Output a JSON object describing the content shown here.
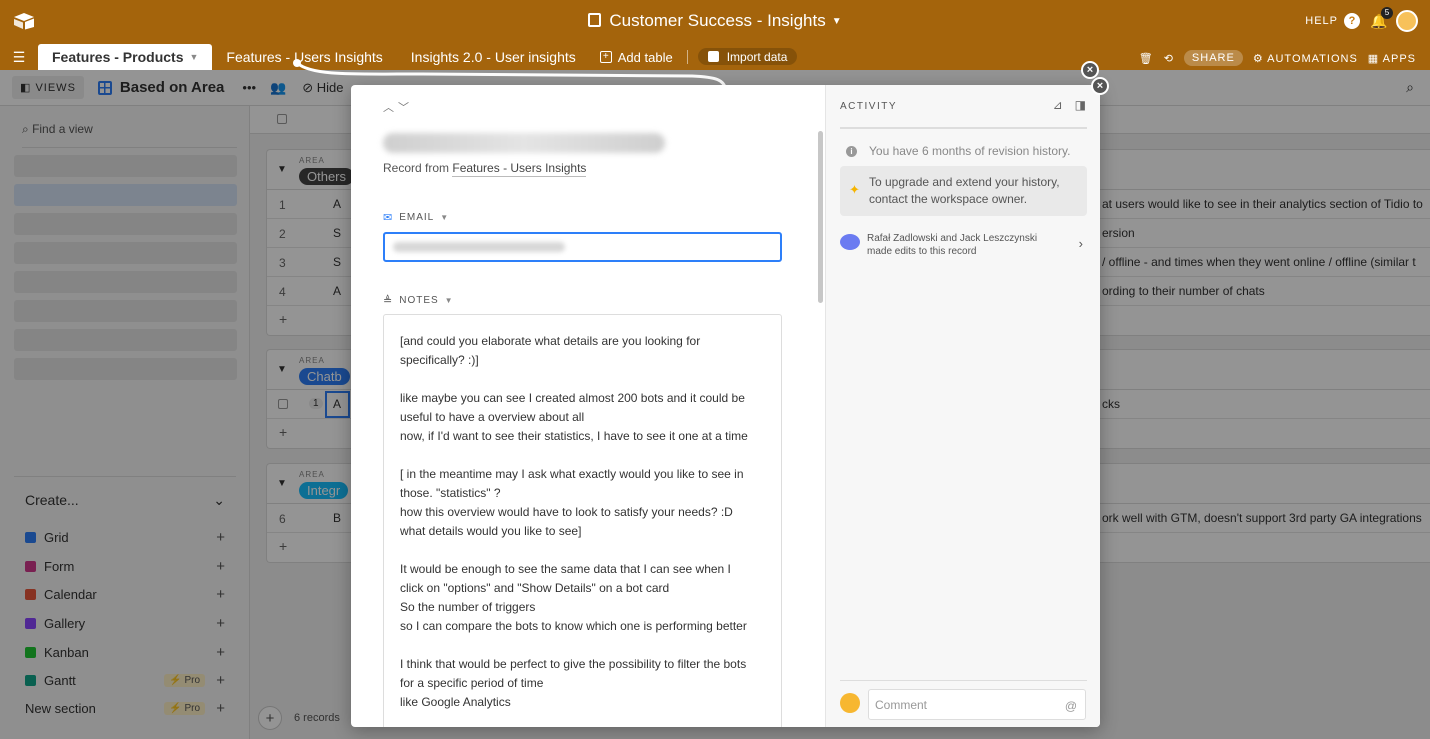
{
  "app": {
    "title": "Customer Success - Insights",
    "help_label": "HELP",
    "notification_count": "5"
  },
  "tabs": {
    "items": [
      {
        "label": "Features - Products",
        "active": true
      },
      {
        "label": "Features - Users Insights",
        "active": false
      },
      {
        "label": "Insights 2.0 - User insights",
        "active": false
      }
    ],
    "add_table": "Add table",
    "import_data": "Import data",
    "share": "SHARE",
    "automations": "AUTOMATIONS",
    "apps": "APPS"
  },
  "toolbar": {
    "views": "VIEWS",
    "view_name": "Based on Area",
    "hide": "Hide"
  },
  "sidebar": {
    "find_view": "Find a view",
    "create": "Create...",
    "types": [
      {
        "label": "Grid",
        "color": "#2d7ff9"
      },
      {
        "label": "Form",
        "color": "#d0388c"
      },
      {
        "label": "Calendar",
        "color": "#e8573c"
      },
      {
        "label": "Gallery",
        "color": "#8b46ff"
      },
      {
        "label": "Kanban",
        "color": "#20c933"
      },
      {
        "label": "Gantt",
        "color": "#11a58a",
        "pro": "Pro"
      }
    ],
    "new_section": "New section",
    "new_section_pro": "Pro"
  },
  "grid": {
    "area_label": "AREA",
    "groups": [
      {
        "name": "Others",
        "color": "#444444",
        "rows": [
          {
            "num": "1",
            "letter": "A",
            "text": "at users would like to see in their analytics section of Tidio to"
          },
          {
            "num": "2",
            "letter": "S",
            "text": "ersion"
          },
          {
            "num": "3",
            "letter": "S",
            "text": "/ offline - and times when they went online / offline (similar t"
          },
          {
            "num": "4",
            "letter": "A",
            "text": "ording to their number of chats"
          }
        ]
      },
      {
        "name": "Chatb",
        "color": "#2d7ff9",
        "rows": [
          {
            "num": "1",
            "letter": "A",
            "text": "cks"
          }
        ]
      },
      {
        "name": "Integr",
        "color": "#18bfff",
        "rows": [
          {
            "num": "6",
            "letter": "B",
            "text": "ork well with GTM, doesn't support 3rd party GA integrations"
          }
        ]
      }
    ],
    "records_count": "6 records"
  },
  "record": {
    "from_prefix": "Record from",
    "from_table": "Features - Users Insights",
    "email_label": "EMAIL",
    "notes_label": "NOTES",
    "notes": "[and could you elaborate what details are you looking for\nspecifically? :)]\n\nlike maybe you can see I created almost 200 bots and it could be\nuseful to have a overview about all\nnow, if I'd want to see their statistics, I have to see it one at a time\n\n[ in the meantime may I ask what exactly would you like to see in\nthose. \"statistics\" ?\nhow this overview would have to look to satisfy your needs? :D\nwhat details would you like to see]\n\nIt would be enough to see the same data that I can see when I\nclick on \"options\" and \"Show Details\" on a bot card\nSo the number of triggers\nso I can compare the bots to know which one is performing better\n\nI think that would be perfect to give the possibility to filter the bots\nfor a specific period of time\nlike Google Analytics"
  },
  "activity": {
    "title": "ACTIVITY",
    "revision": "You have 6 months of revision history.",
    "upgrade_line1": "To upgrade and extend your history,",
    "upgrade_line2": "contact the workspace owner.",
    "edits_line1": "Rafał Zadlowski and Jack Leszczynski",
    "edits_line2": "made edits to this record",
    "comment_placeholder": "Comment",
    "comment_at": "@"
  }
}
